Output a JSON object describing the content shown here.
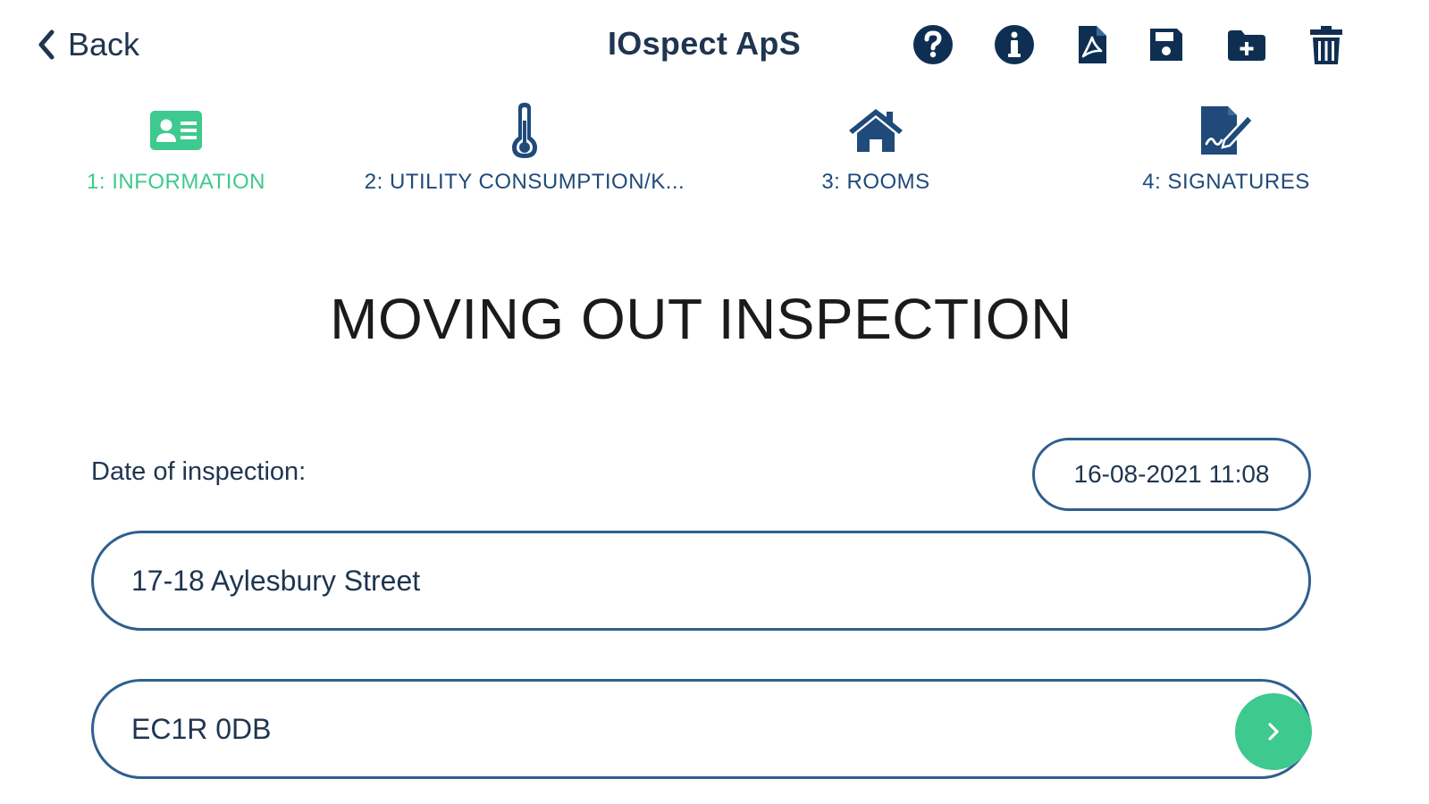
{
  "header": {
    "back_label": "Back",
    "title": "IOspect ApS"
  },
  "toolbar": {
    "icons": [
      "help-icon",
      "info-icon",
      "pdf-icon",
      "save-icon",
      "folder-add-icon",
      "trash-icon"
    ]
  },
  "tabs": [
    {
      "label": "1: INFORMATION",
      "icon": "id-card-icon",
      "active": true
    },
    {
      "label": "2: UTILITY CONSUMPTION/K...",
      "icon": "thermometer-icon",
      "active": false
    },
    {
      "label": "3: ROOMS",
      "icon": "house-icon",
      "active": false
    },
    {
      "label": "4: SIGNATURES",
      "icon": "signature-icon",
      "active": false
    }
  ],
  "page": {
    "title": "MOVING OUT INSPECTION"
  },
  "form": {
    "date_label": "Date of inspection:",
    "date_value": "16-08-2021 11:08",
    "address_value": "17-18 Aylesbury Street",
    "postcode_value": "EC1R 0DB"
  },
  "colors": {
    "primary": "#1f4a7a",
    "accent": "#3ec98e",
    "border": "#2f5f8f",
    "text": "#1f3550"
  }
}
